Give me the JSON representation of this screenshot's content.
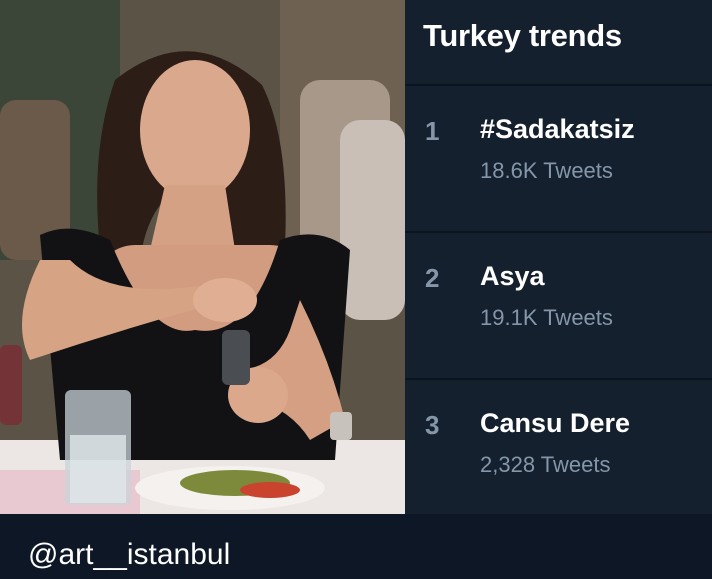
{
  "trends_panel": {
    "title": "Turkey trends",
    "items": [
      {
        "rank": "1",
        "name": "#Sadakatsiz",
        "count": "18.6K Tweets"
      },
      {
        "rank": "2",
        "name": "Asya",
        "count": "19.1K Tweets"
      },
      {
        "rank": "3",
        "name": "Cansu Dere",
        "count": "2,328 Tweets"
      }
    ]
  },
  "footer": {
    "watermark": "@art__istanbul"
  },
  "colors": {
    "panel_bg": "#14202d",
    "page_bg": "#0d1726",
    "secondary_text": "#8496a8"
  }
}
